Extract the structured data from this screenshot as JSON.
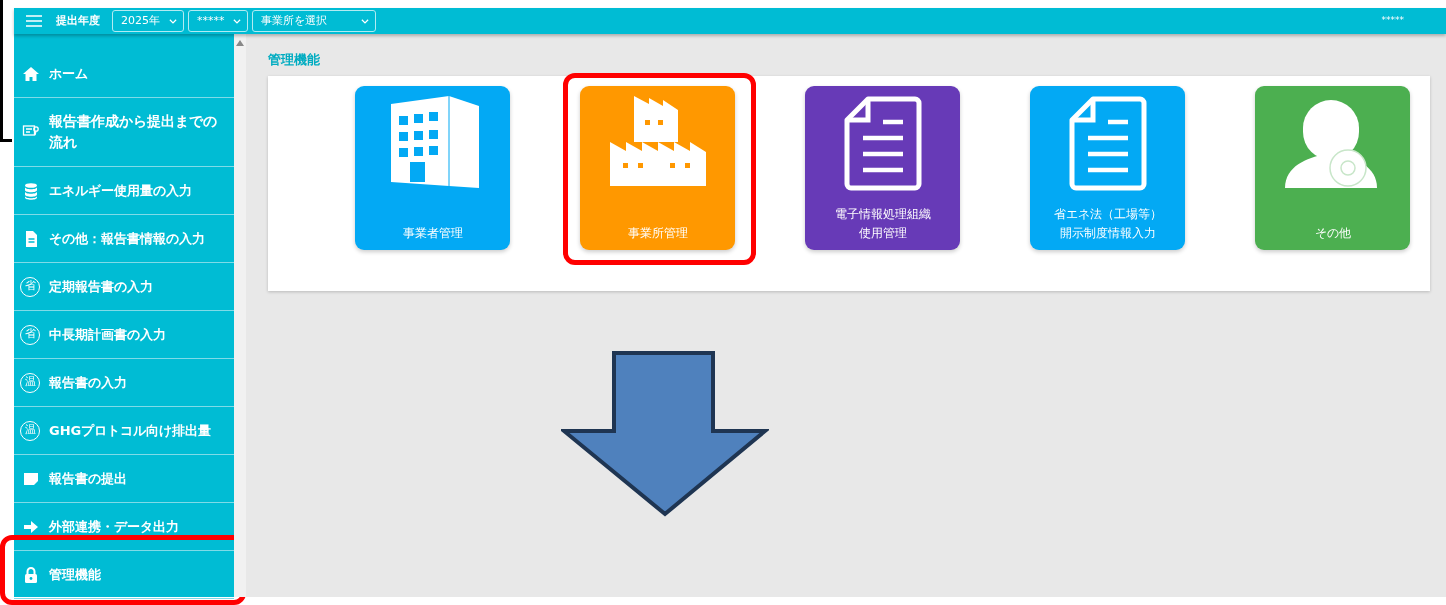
{
  "topbar": {
    "year_label": "提出年度",
    "selects": [
      {
        "value": "2025年"
      },
      {
        "value": "*****"
      },
      {
        "value": "事業所を選択"
      }
    ],
    "user": "*****"
  },
  "sidebar": {
    "items": [
      {
        "label": "ホーム",
        "kind": "home",
        "highlighted": false
      },
      {
        "label": "報告書作成から提出までの流れ",
        "kind": "flow",
        "highlighted": false
      },
      {
        "label": "エネルギー使用量の入力",
        "kind": "database",
        "highlighted": false
      },
      {
        "label": "その他：報告書情報の入力",
        "kind": "file",
        "highlighted": false
      },
      {
        "label": "定期報告書の入力",
        "kind": "badge",
        "badge": "省",
        "highlighted": false
      },
      {
        "label": "中長期計画書の入力",
        "kind": "badge",
        "badge": "省",
        "highlighted": false
      },
      {
        "label": "報告書の入力",
        "kind": "badge",
        "badge": "温",
        "highlighted": false
      },
      {
        "label": "GHGプロトコル向け排出量",
        "kind": "badge",
        "badge": "温",
        "highlighted": false
      },
      {
        "label": "報告書の提出",
        "kind": "note",
        "highlighted": false
      },
      {
        "label": "外部連携・データ出力",
        "kind": "arrow",
        "highlighted": false
      },
      {
        "label": "管理機能",
        "kind": "lock",
        "highlighted": true
      }
    ]
  },
  "main": {
    "heading": "管理機能",
    "tiles": [
      {
        "lines": [
          "事業者管理"
        ],
        "kind": "building",
        "color": "#03a9f4",
        "highlighted": false
      },
      {
        "lines": [
          "事業所管理"
        ],
        "kind": "factory",
        "color": "#ff9800",
        "highlighted": true
      },
      {
        "lines": [
          "電子情報処理組織",
          "使用管理"
        ],
        "kind": "document",
        "color": "#673ab7",
        "highlighted": false
      },
      {
        "lines": [
          "省エネ法（工場等）",
          "開示制度情報入力"
        ],
        "kind": "document",
        "color": "#03a9f4",
        "highlighted": false
      },
      {
        "lines": [
          "その他"
        ],
        "kind": "person",
        "color": "#4caf50",
        "highlighted": false
      }
    ]
  },
  "annotation": {
    "down_arrow": true
  }
}
